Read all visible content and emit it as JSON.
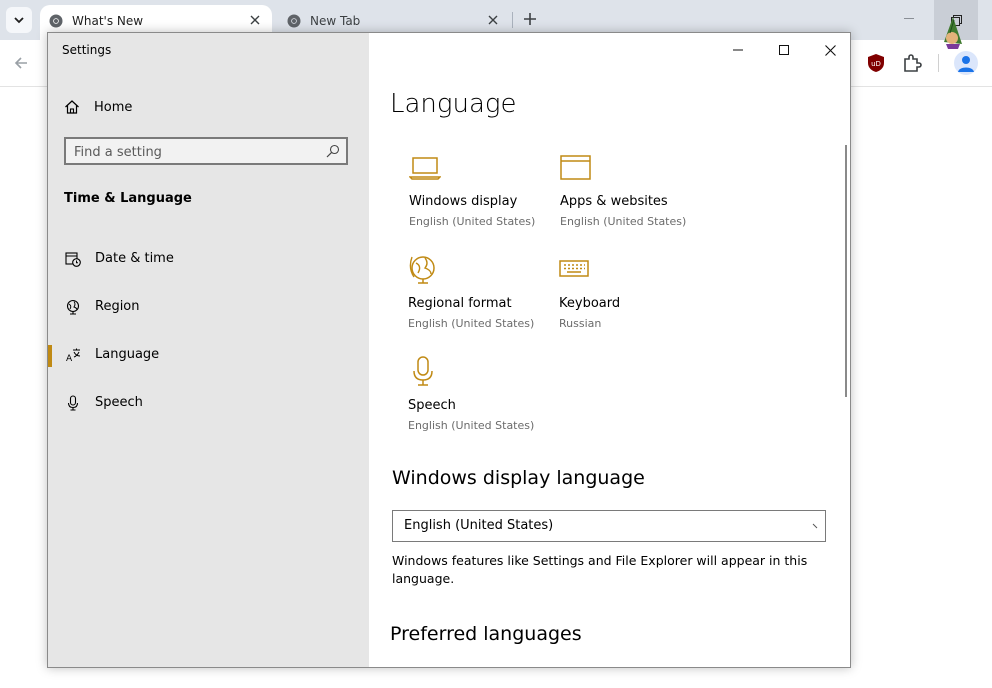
{
  "browser": {
    "tabs": [
      {
        "title": "What's New",
        "active": true
      },
      {
        "title": "New Tab",
        "active": false
      }
    ]
  },
  "settings": {
    "window_title": "Settings",
    "sidebar": {
      "home_label": "Home",
      "search_placeholder": "Find a setting",
      "section_title": "Time & Language",
      "items": [
        {
          "label": "Date & time",
          "icon": "calendar-clock-icon"
        },
        {
          "label": "Region",
          "icon": "globe-icon"
        },
        {
          "label": "Language",
          "icon": "language-icon",
          "selected": true
        },
        {
          "label": "Speech",
          "icon": "microphone-icon"
        }
      ]
    },
    "main": {
      "page_title": "Language",
      "tiles": [
        {
          "name": "Windows display",
          "value": "English (United States)",
          "icon": "laptop-icon"
        },
        {
          "name": "Apps & websites",
          "value": "English (United States)",
          "icon": "window-icon"
        },
        {
          "name": "Regional format",
          "value": "English (United States)",
          "icon": "globe-icon"
        },
        {
          "name": "Keyboard",
          "value": "Russian",
          "icon": "keyboard-icon"
        },
        {
          "name": "Speech",
          "value": "English (United States)",
          "icon": "microphone-icon"
        }
      ],
      "display_language": {
        "heading": "Windows display language",
        "selected": "English (United States)",
        "description": "Windows features like Settings and File Explorer will appear in this language."
      },
      "preferred_heading": "Preferred languages"
    }
  },
  "colors": {
    "accent": "#c08a14",
    "sidebar_bg": "#e6e6e6",
    "tabstrip_bg": "#dee3ea"
  }
}
